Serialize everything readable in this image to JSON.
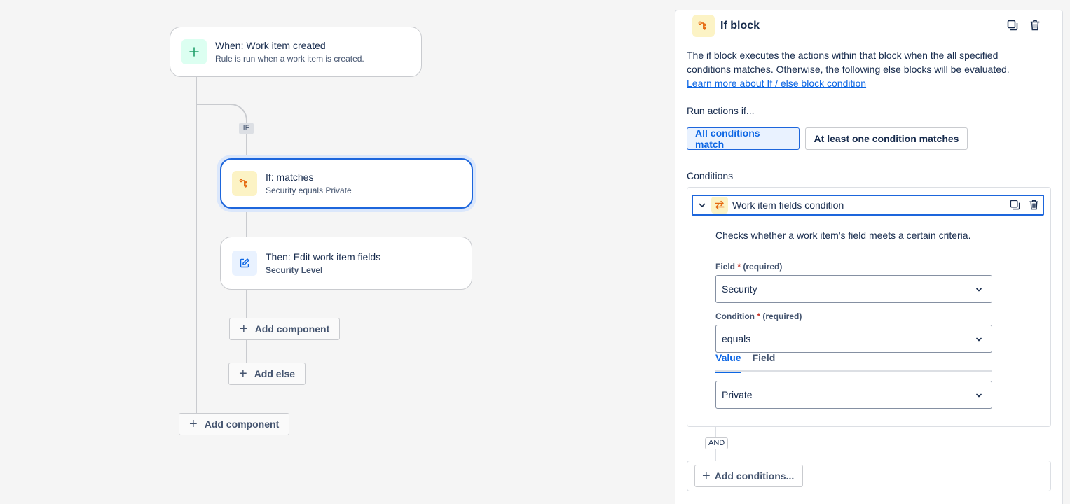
{
  "flow": {
    "trigger": {
      "title": "When: Work item created",
      "subtitle": "Rule is run when a work item is created."
    },
    "if_tag": "IF",
    "if_card": {
      "title": "If: matches",
      "subtitle": "Security equals Private"
    },
    "then_card": {
      "title": "Then: Edit work item fields",
      "subtitle": "Security Level"
    },
    "add_component_inner": "Add component",
    "add_else": "Add else",
    "add_component_outer": "Add component"
  },
  "panel": {
    "title": "If block",
    "description": "The if block executes the actions within that block when the all specified conditions matches. Otherwise, the following else blocks will be evaluated.",
    "learn_more_link": "Learn more about If / else block condition",
    "run_actions_label": "Run actions if...",
    "match_options": [
      "All conditions match",
      "At least one condition matches"
    ],
    "selected_match": "All conditions match",
    "conditions_label": "Conditions",
    "condition": {
      "title": "Work item fields condition",
      "description": "Checks whether a work item's field meets a certain criteria.",
      "field_label": "Field",
      "field_required": "(required)",
      "field_value": "Security",
      "condition_label": "Condition",
      "condition_required": "(required)",
      "condition_value": "equals",
      "tabs": [
        "Value",
        "Field"
      ],
      "active_tab": "Value",
      "value_value": "Private"
    },
    "and_tag": "AND",
    "add_conditions": "Add conditions..."
  },
  "colors": {
    "accent": "#0c66e4",
    "trigger_icon_bg": "#dcfff1",
    "if_icon_bg": "#fcf3c5",
    "then_icon_bg": "#e9f2ff"
  },
  "icons": {
    "trigger": "plus-icon",
    "if": "branch-icon",
    "then": "edit-icon",
    "copy": "copy-icon",
    "delete": "trash-icon",
    "chevron": "chevron-down-icon",
    "condition": "swap-icon"
  }
}
